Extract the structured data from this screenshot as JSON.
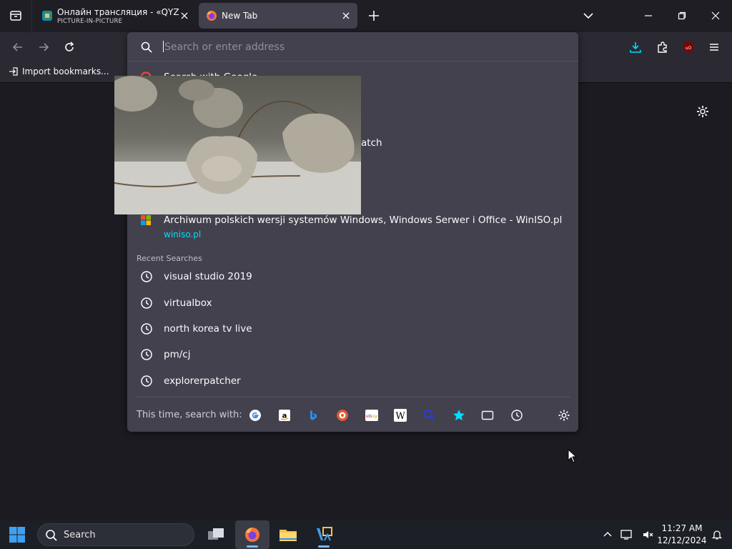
{
  "tabs": [
    {
      "title": "Онлайн трансляция - «QYZYL",
      "subtitle": "PICTURE-IN-PICTURE"
    },
    {
      "title": "New Tab"
    }
  ],
  "bookmarks": {
    "import_label": "Import bookmarks..."
  },
  "urlbar": {
    "placeholder": "Search or enter address",
    "first_suggestion": "Search with Google",
    "partial_suggestion": "atch",
    "top_site": {
      "title": "Archiwum polskich wersji systemów Windows, Windows Serwer i Office - WinISO.pl",
      "url": "winiso.pl"
    },
    "recent_header": "Recent Searches",
    "recent_searches": [
      "visual studio 2019",
      "virtualbox",
      "north korea tv live",
      "pm/cj",
      "explorerpatcher"
    ],
    "search_with_label": "This time, search with:",
    "engines": [
      "google-icon",
      "amazon-icon",
      "bing-icon",
      "duckduckgo-icon",
      "ebay-icon",
      "wikipedia-icon",
      "search-engine-icon",
      "bookmarks-icon",
      "tabs-icon",
      "history-icon"
    ]
  },
  "taskbar": {
    "search_label": "Search",
    "time": "11:27 AM",
    "date": "12/12/2024"
  },
  "colors": {
    "accent": "#00ddff",
    "tab_active": "#42414d",
    "panel": "#42414d",
    "background": "#1c1b22"
  }
}
